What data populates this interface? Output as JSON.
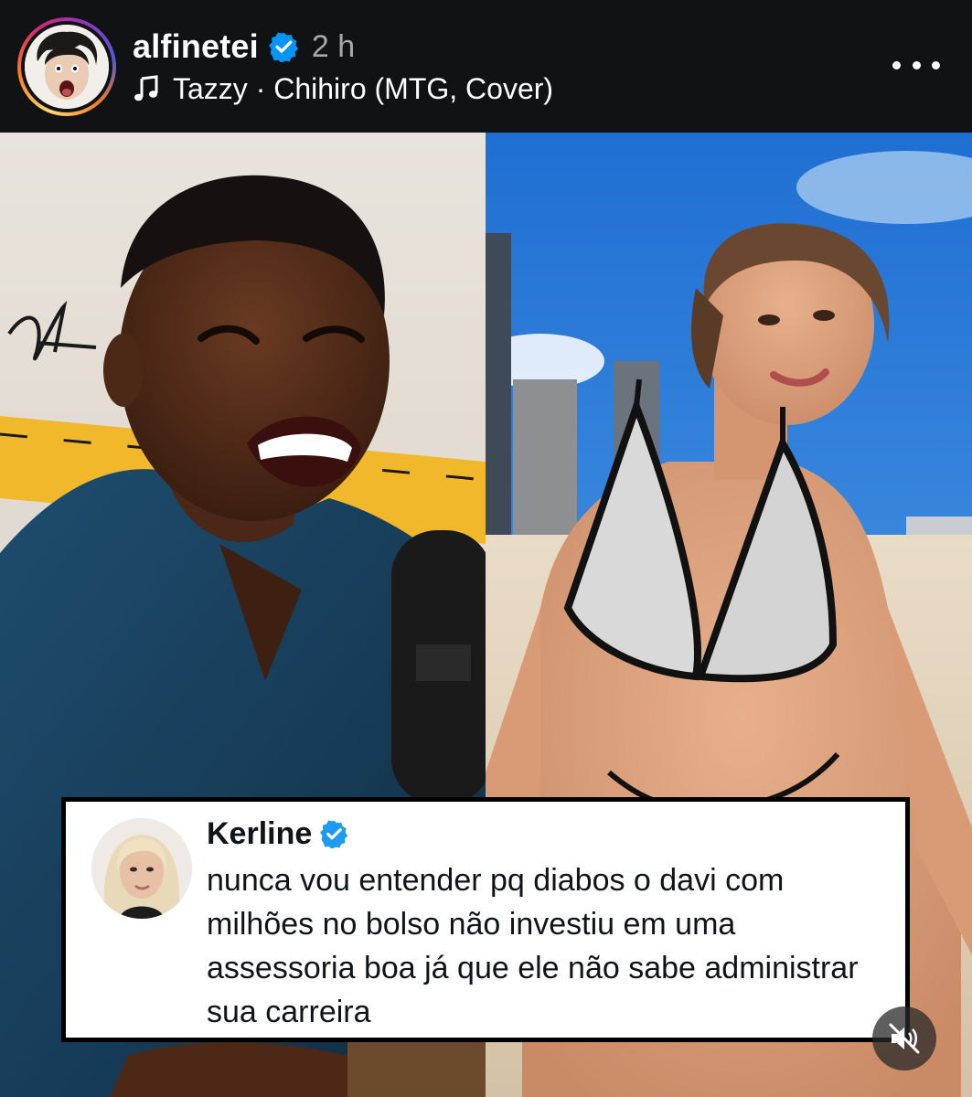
{
  "post": {
    "username": "alfinetei",
    "time": "2 h",
    "music": "Tazzy · Chihiro (MTG, Cover)"
  },
  "tweet": {
    "name": "Kerline",
    "text": "nunca vou entender pq diabos o davi com milhões no bolso não investiu em uma assessoria boa já que ele não sabe administrar sua carreira"
  },
  "icons": {
    "verified": "verified-badge-icon",
    "music": "music-note-icon",
    "more": "more-options-icon",
    "mute": "muted-speaker-icon"
  },
  "colors": {
    "verified_blue": "#0095f6",
    "header_bg": "#111214",
    "time_gray": "#a8a8a8"
  }
}
